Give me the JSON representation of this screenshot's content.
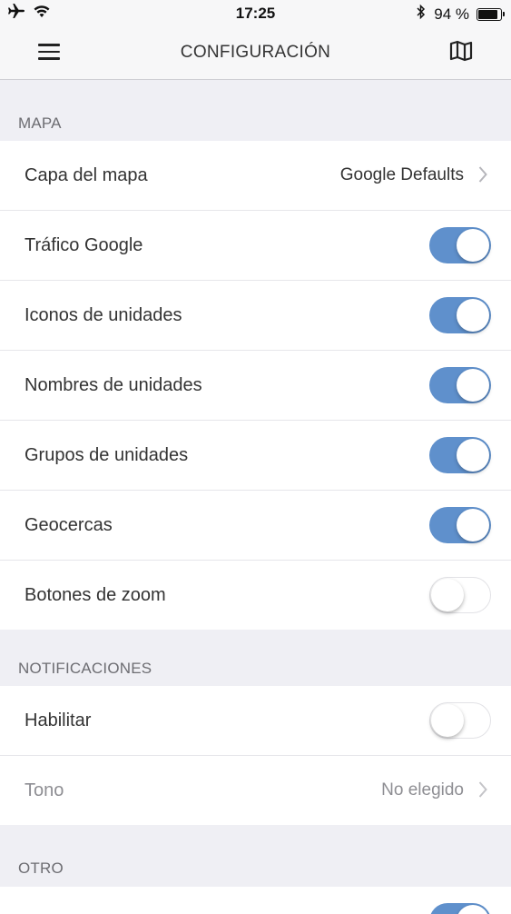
{
  "status": {
    "time": "17:25",
    "battery_text": "94 %",
    "battery_level": 0.94,
    "icons": [
      "airplane-icon",
      "wifi-icon",
      "bluetooth-icon",
      "battery-icon"
    ]
  },
  "nav": {
    "title": "CONFIGURACIÓN",
    "left_icon": "menu-icon",
    "right_icon": "map-icon"
  },
  "sections": {
    "mapa": {
      "header": "MAPA",
      "layer": {
        "label": "Capa del mapa",
        "value": "Google Defaults"
      },
      "traffic": {
        "label": "Tráfico Google",
        "on": true
      },
      "unit_icons": {
        "label": "Iconos de unidades",
        "on": true
      },
      "unit_names": {
        "label": "Nombres de unidades",
        "on": true
      },
      "unit_groups": {
        "label": "Grupos de unidades",
        "on": true
      },
      "geofences": {
        "label": "Geocercas",
        "on": true
      },
      "zoom_buttons": {
        "label": "Botones de zoom",
        "on": false
      }
    },
    "notificaciones": {
      "header": "NOTIFICACIONES",
      "enable": {
        "label": "Habilitar",
        "on": false
      },
      "tone": {
        "label": "Tono",
        "value": "No elegido"
      }
    },
    "otro": {
      "header": "OTRO"
    }
  },
  "colors": {
    "toggle_on": "#5f90cc",
    "background": "#efeff4"
  }
}
